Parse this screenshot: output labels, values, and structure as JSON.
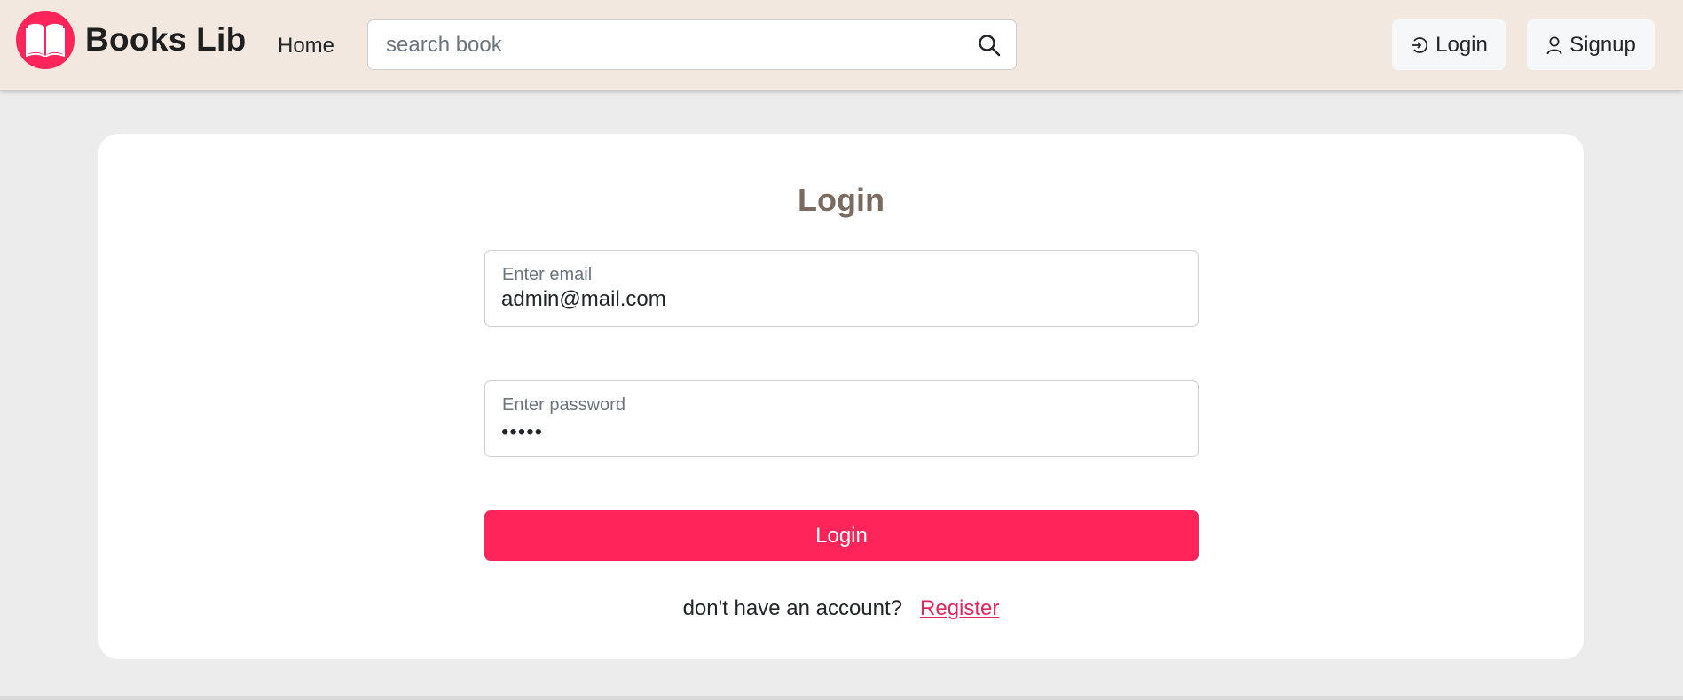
{
  "navbar": {
    "brand_name": "Books Lib",
    "home_label": "Home",
    "search": {
      "placeholder": "search book",
      "value": ""
    },
    "login_label": "Login",
    "signup_label": "Signup"
  },
  "login_form": {
    "title": "Login",
    "email": {
      "label": "Enter email",
      "value": "admin@mail.com"
    },
    "password": {
      "label": "Enter password",
      "masked_value": "•••••"
    },
    "submit_label": "Login",
    "register_prompt": "don't have an account?",
    "register_link": "Register"
  },
  "colors": {
    "accent": "#ff2459",
    "navbar_bg": "#f3e8df",
    "page_bg": "#ececec",
    "title": "#7a6a60"
  },
  "icons": {
    "brand": "open-book-icon",
    "search": "search-icon",
    "login": "login-icon",
    "signup": "user-icon"
  }
}
